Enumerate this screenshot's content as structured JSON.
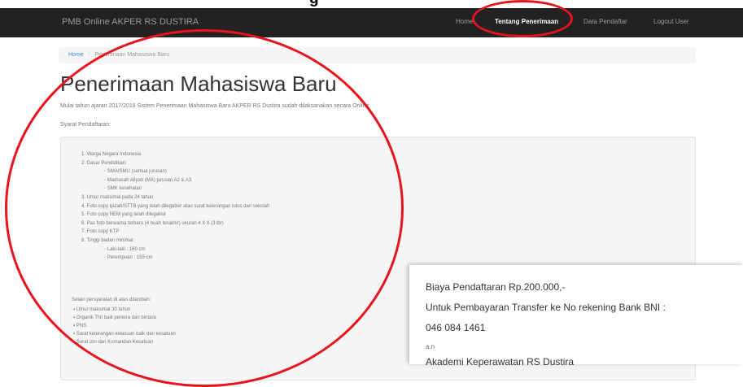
{
  "top_caption": "g",
  "navbar": {
    "brand": "PMB Online AKPER RS DUSTIRA",
    "items": [
      {
        "label": "Home"
      },
      {
        "label": "Tentang Penerimaan"
      },
      {
        "label": "Data Pendaftar"
      },
      {
        "label": "Logout User"
      }
    ]
  },
  "breadcrumb": {
    "home": "Home",
    "separator": "/",
    "current": "Penerimaan Mahasiswa Baru"
  },
  "page": {
    "title": "Penerimaan Mahasiswa Baru",
    "intro": "Mulai tahun ajaran 2017/2018 Sistem Penerimaan Mahasiswa Baru AKPER RS Dustira sudah dilaksanakan secara Online",
    "syarat_title": "Syarat Pendaftaran:"
  },
  "requirements": [
    {
      "text": "1. Warga Negara Indonesia",
      "sub": false
    },
    {
      "text": "2. Dasar Pendidikan:",
      "sub": false
    },
    {
      "text": "◦ SMA/SMU (semua jurusan)",
      "sub": true
    },
    {
      "text": "◦ Madrasah Aliyah (MA) jurusan A2 & A3",
      "sub": true
    },
    {
      "text": "◦ SMK kesehatan",
      "sub": true
    },
    {
      "text": "3. Umur maksimal pada 24 tahun",
      "sub": false
    },
    {
      "text": "4. Foto copy ijazah/STTB yang telah dilegalisir atau surat keterangan lulus dari sekolah",
      "sub": false
    },
    {
      "text": "5. Foto copy NEM yang telah dilegalisir",
      "sub": false
    },
    {
      "text": "6. Pas foto berwarna terbaru (4 buah terakhir) ukuran 4 X 6 (3 lbr)",
      "sub": false
    },
    {
      "text": "7. Foto copy KTP",
      "sub": false
    },
    {
      "text": "8. Tinggi badan minimal:",
      "sub": false
    },
    {
      "text": "◦ Laki-laki : 160 cm",
      "sub": true
    },
    {
      "text": "◦ Perempuan : 155 cm",
      "sub": true
    }
  ],
  "selain": "Selain persyaratan di atas ditambah:",
  "additional": [
    "▪ Umur maksimal 30 tahun",
    "▪ Organik TNI baik perwira dan bintara",
    "▪ PNS",
    "▪ Surat keterangan kelakuan baik dari kesatuan",
    "▪ Surat izin dari Komandan Kesatuan"
  ],
  "payment": {
    "fee": "Biaya Pendaftaran Rp.200.000,-",
    "transfer": "Untuk Pembayaran Transfer ke No rekening Bank BNI :",
    "account": "046 084 1461",
    "an": "a.n",
    "holder": "Akademi Keperawatan RS Dustira"
  },
  "colors": {
    "navbar": "#222222",
    "annotation": "#e8141d",
    "link": "#428bca"
  }
}
